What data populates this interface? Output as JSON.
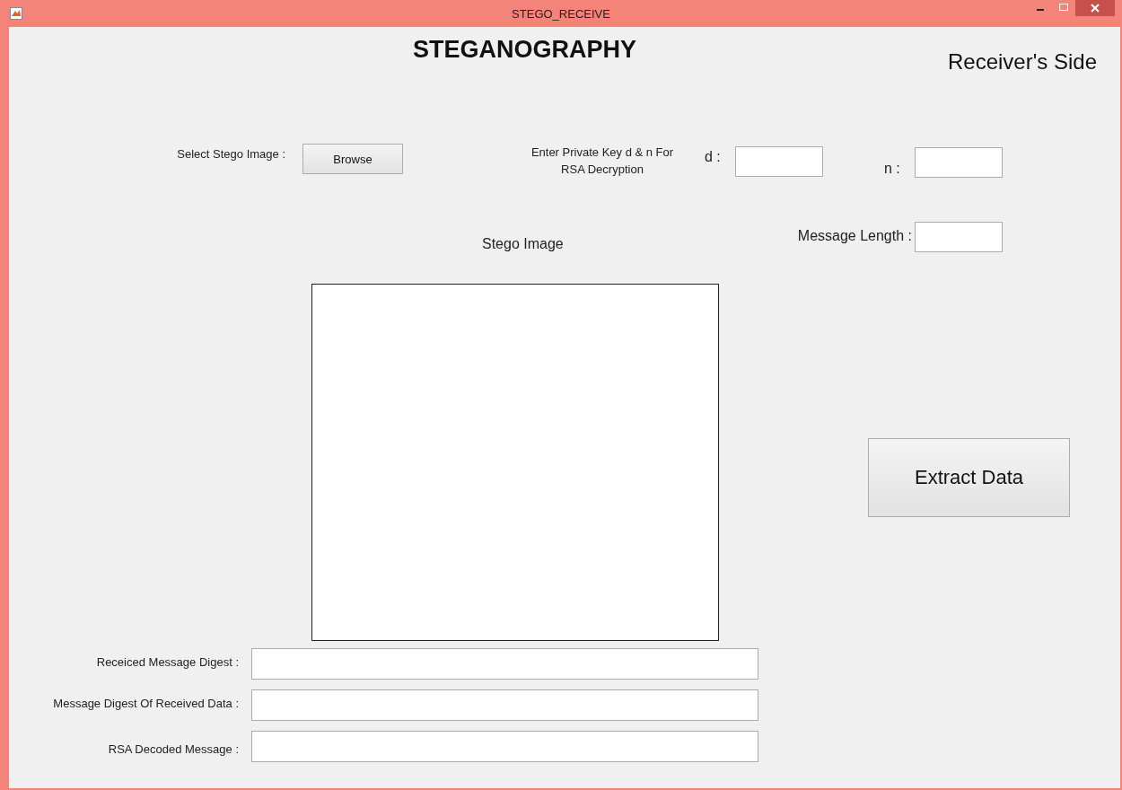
{
  "window": {
    "title": "STEGO_RECEIVE"
  },
  "heading": "STEGANOGRAPHY",
  "subtitle": "Receiver's Side",
  "select_image": {
    "label": "Select Stego Image :",
    "button": "Browse"
  },
  "key_prompt": [
    "Enter Private Key d & n For",
    "RSA Decryption"
  ],
  "key_fields": [
    {
      "label": "d :"
    },
    {
      "label": "n :"
    }
  ],
  "message_length": {
    "label": "Message Length :"
  },
  "image_panel": {
    "label": "Stego Image"
  },
  "extract_button": "Extract Data",
  "result_fields": [
    {
      "label": "Receiced Message Digest :"
    },
    {
      "label": "Message Digest Of Received Data :"
    },
    {
      "label": "RSA Decoded Message :"
    }
  ]
}
